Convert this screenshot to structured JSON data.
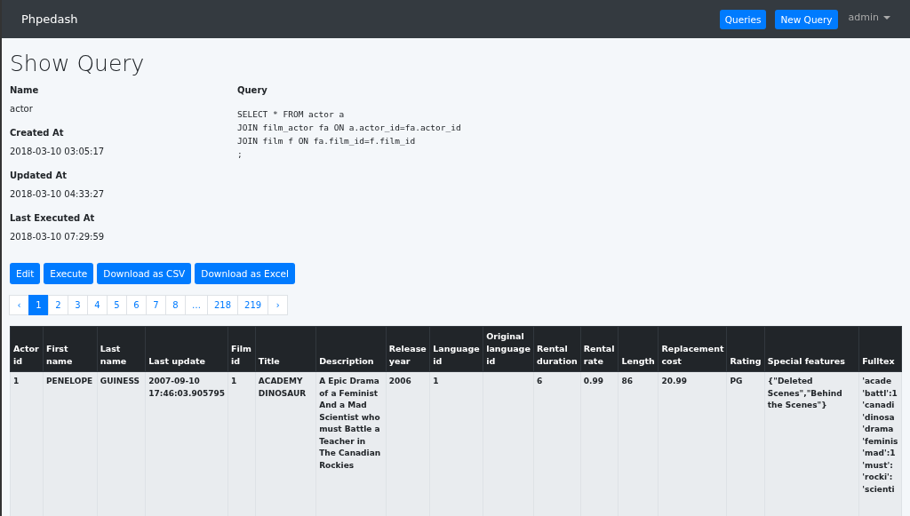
{
  "navbar": {
    "brand": "Phpedash",
    "buttons": [
      "Queries",
      "New Query"
    ],
    "user_menu": "admin"
  },
  "page": {
    "title": "Show Query"
  },
  "details": [
    {
      "label": "Name",
      "value": "actor"
    },
    {
      "label": "Created At",
      "value": "2018-03-10 03:05:17"
    },
    {
      "label": "Updated At",
      "value": "2018-03-10 04:33:27"
    },
    {
      "label": "Last Executed At",
      "value": "2018-03-10 07:29:59"
    }
  ],
  "query": {
    "label": "Query",
    "sql": "SELECT * FROM actor a\nJOIN film_actor fa ON a.actor_id=fa.actor_id\nJOIN film f ON fa.film_id=f.film_id\n;"
  },
  "actions": [
    "Edit",
    "Execute",
    "Download as CSV",
    "Download as Excel"
  ],
  "pagination": {
    "prev": "‹",
    "next": "›",
    "pages": [
      {
        "label": "1",
        "selected": true
      },
      {
        "label": "2",
        "selected": false
      },
      {
        "label": "3",
        "selected": false
      },
      {
        "label": "4",
        "selected": false
      },
      {
        "label": "5",
        "selected": false
      },
      {
        "label": "6",
        "selected": false
      },
      {
        "label": "7",
        "selected": false
      },
      {
        "label": "8",
        "selected": false
      },
      {
        "label": "…",
        "selected": false
      },
      {
        "label": "218",
        "selected": false
      },
      {
        "label": "219",
        "selected": false
      }
    ]
  },
  "table": {
    "columns": [
      "Actor id",
      "First name",
      "Last name",
      "Last update",
      "Film id",
      "Title",
      "Description",
      "Release year",
      "Language id",
      "Original language id",
      "Rental duration",
      "Rental rate",
      "Length",
      "Replacement cost",
      "Rating",
      "Special features",
      "Fulltex"
    ],
    "rows": [
      [
        "1",
        "PENELOPE",
        "GUINESS",
        "2007-09-10 17:46:03.905795",
        "1",
        "ACADEMY DINOSAUR",
        "A Epic Drama of a Feminist And a Mad Scientist who must Battle a Teacher in The Canadian Rockies",
        "2006",
        "1",
        "",
        "6",
        "0.99",
        "86",
        "20.99",
        "PG",
        "{\"Deleted Scenes\",\"Behind the Scenes\"}",
        "'acade\n'battl':1\n'canadi\n'dinosa\n'drama\n'feminis\n'mad':1\n'must':\n'rocki':\n'scienti"
      ]
    ]
  }
}
